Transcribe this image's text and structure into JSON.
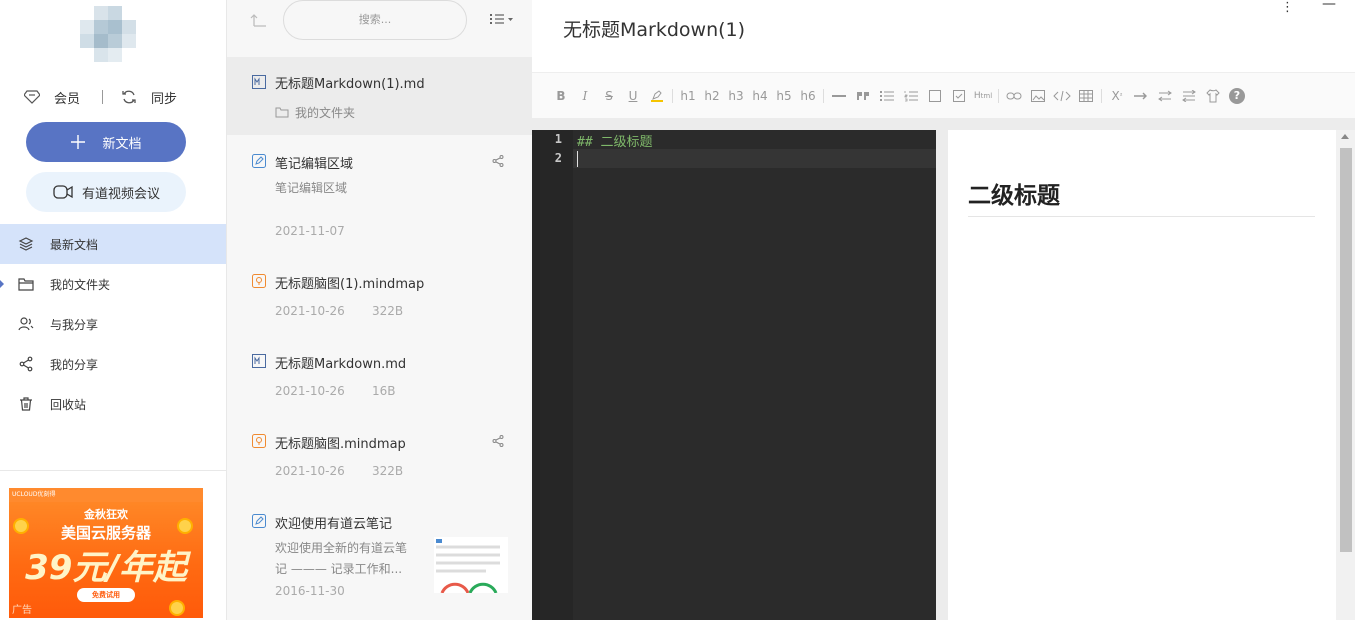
{
  "sidebar": {
    "vip_label": "会员",
    "sync_label": "同步",
    "new_doc_label": "新文档",
    "meeting_label": "有道视频会议",
    "nav": [
      {
        "label": "最新文档",
        "icon": "layers-icon",
        "active": true
      },
      {
        "label": "我的文件夹",
        "icon": "folder-icon",
        "active": false
      },
      {
        "label": "与我分享",
        "icon": "shared-users-icon",
        "active": false
      },
      {
        "label": "我的分享",
        "icon": "share-icon",
        "active": false
      },
      {
        "label": "回收站",
        "icon": "trash-icon",
        "active": false
      }
    ],
    "ad": {
      "brand": "UCLOUD优刻得",
      "line1": "金秋狂欢",
      "line2": "美国云服务器",
      "price": "39元/年起",
      "button": "免费试用",
      "tag": "广告"
    }
  },
  "doclist": {
    "search_placeholder": "搜索...",
    "items": [
      {
        "title": "无标题Markdown(1).md",
        "sub": "我的文件夹",
        "icon": "markdown-icon",
        "selected": true
      },
      {
        "title": "笔记编辑区域",
        "sub": "笔记编辑区域",
        "date": "2021-11-07",
        "icon": "note-icon",
        "shared": true
      },
      {
        "title": "无标题脑图(1).mindmap",
        "date": "2021-10-26",
        "size": "322B",
        "icon": "mindmap-icon"
      },
      {
        "title": "无标题Markdown.md",
        "date": "2021-10-26",
        "size": "16B",
        "icon": "markdown-icon"
      },
      {
        "title": "无标题脑图.mindmap",
        "date": "2021-10-26",
        "size": "322B",
        "icon": "mindmap-icon",
        "shared": true
      },
      {
        "title": "欢迎使用有道云笔记",
        "sub1": "欢迎使用全新的有道云笔",
        "sub2": "记 ——— 记录工作和...",
        "date": "2016-11-30",
        "icon": "note-icon"
      }
    ]
  },
  "editor": {
    "title": "无标题Markdown(1)",
    "toolbar": [
      "B",
      "I",
      "S",
      "U",
      "highlight",
      "h1",
      "h2",
      "h3",
      "h4",
      "h5",
      "h6",
      "hr",
      "quote",
      "ul",
      "ol",
      "checkbox",
      "checked",
      "html",
      "link",
      "image",
      "code",
      "table",
      "superscript",
      "arrow-right",
      "swap",
      "align",
      "shirt",
      "help"
    ],
    "line_numbers": [
      "1",
      "2"
    ],
    "code_line_1": "## 二级标题",
    "preview_h2": "二级标题"
  },
  "colors": {
    "accent": "#5874c4",
    "nav_active_bg": "#d5e3fa",
    "code_bg": "#2b2b2b",
    "code_green": "#7fb86a"
  }
}
